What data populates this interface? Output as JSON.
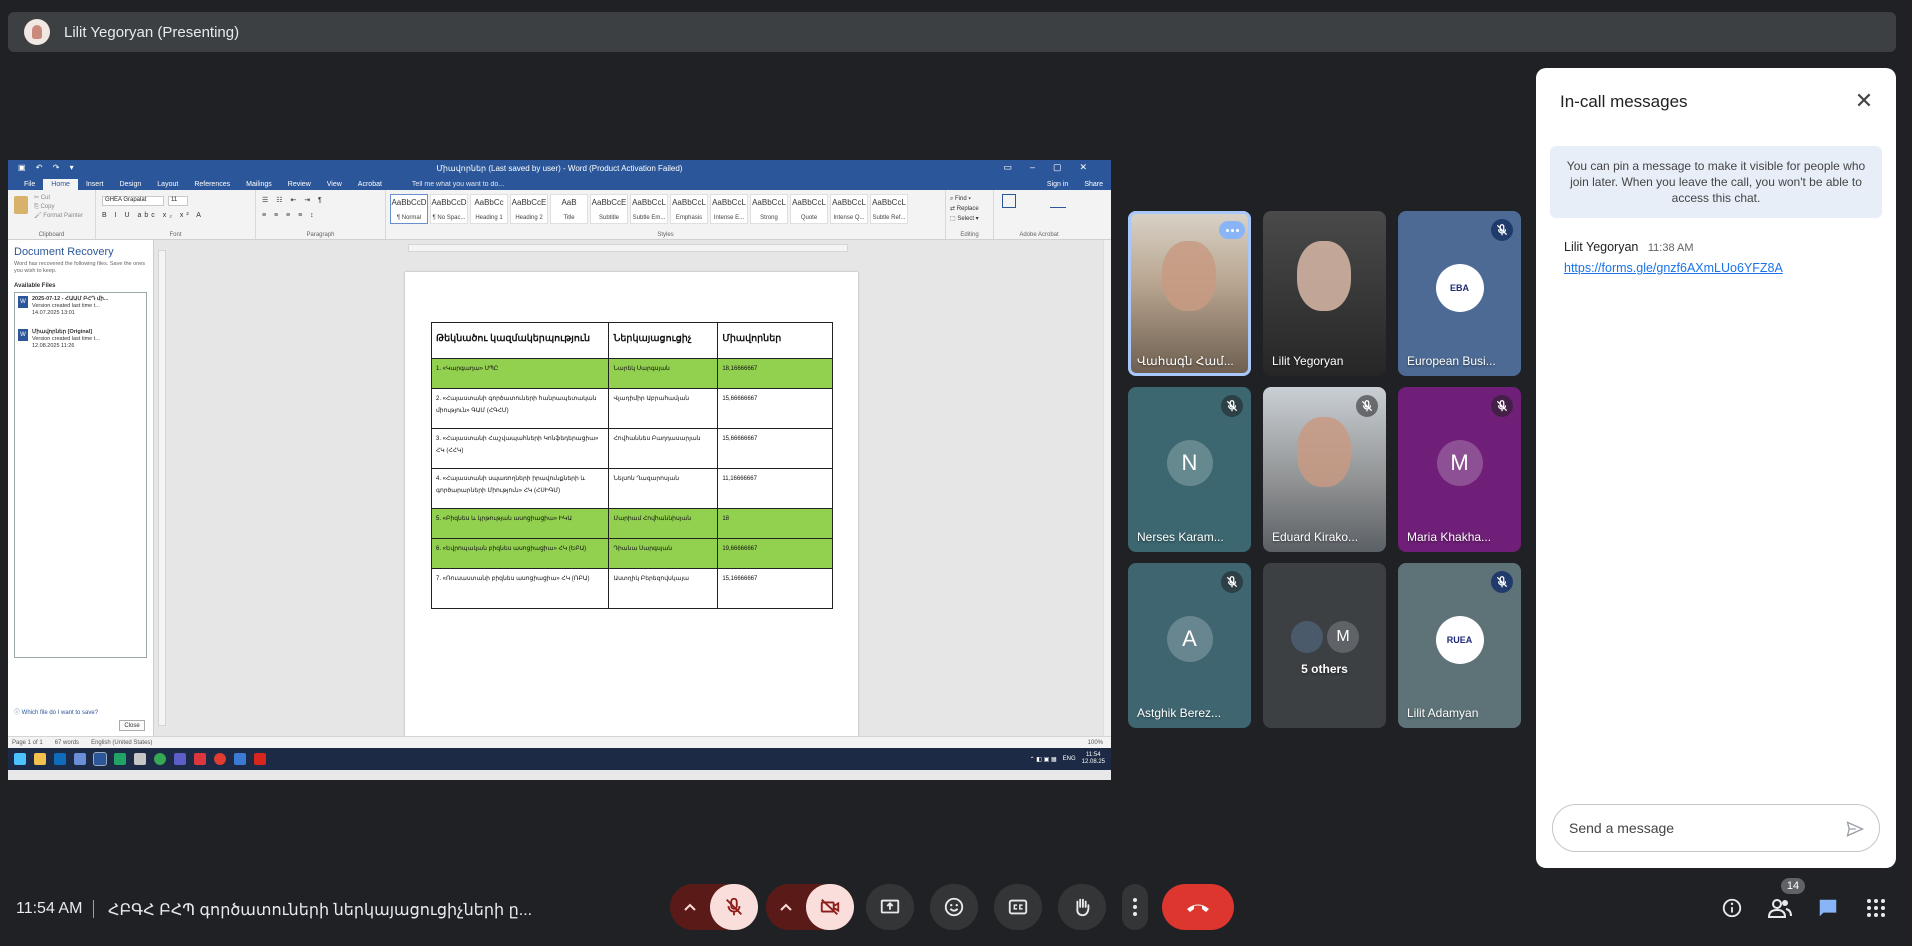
{
  "presenter": {
    "name": "Lilit Yegoryan (Presenting)"
  },
  "word": {
    "window_title": "Միավորներ (Last saved by user) - Word (Product Activation Failed)",
    "tabs": [
      "File",
      "Home",
      "Insert",
      "Design",
      "Layout",
      "References",
      "Mailings",
      "Review",
      "View",
      "Acrobat"
    ],
    "tell_me": "Tell me what you want to do...",
    "sign_in": "Sign in",
    "share": "Share",
    "font_name": "GHEA Grapalat",
    "font_size": "11",
    "groups": [
      "Clipboard",
      "Font",
      "Paragraph",
      "Styles",
      "Editing",
      "Adobe Acrobat"
    ],
    "styles": [
      {
        "sample": "AaBbCcD",
        "name": "¶ Normal"
      },
      {
        "sample": "AaBbCcD",
        "name": "¶ No Spac..."
      },
      {
        "sample": "AaBbCc",
        "name": "Heading 1"
      },
      {
        "sample": "AaBbCcE",
        "name": "Heading 2"
      },
      {
        "sample": "AaB",
        "name": "Title"
      },
      {
        "sample": "AaBbCcE",
        "name": "Subtitle"
      },
      {
        "sample": "AaBbCcL",
        "name": "Subtle Em..."
      },
      {
        "sample": "AaBbCcL",
        "name": "Emphasis"
      },
      {
        "sample": "AaBbCcL",
        "name": "Intense E..."
      },
      {
        "sample": "AaBbCcL",
        "name": "Strong"
      },
      {
        "sample": "AaBbCcL",
        "name": "Quote"
      },
      {
        "sample": "AaBbCcL",
        "name": "Intense Q..."
      },
      {
        "sample": "AaBbCcL",
        "name": "Subtle Ref..."
      }
    ],
    "recovery": {
      "title": "Document Recovery",
      "subtitle": "Word has recovered the following files. Save the ones you wish to keep.",
      "available": "Available Files",
      "files": [
        {
          "name": "2025-07-12 - ՀԱԱՄ ԲՀԴ մի...",
          "line1": "Version created last time t...",
          "line2": "14.07.2025 13:01"
        },
        {
          "name": "Միավորներ  [Original]",
          "line1": "Version created last time t...",
          "line2": "12.08.2025 11:26"
        }
      ],
      "help": "Which file do I want to save?",
      "close": "Close"
    },
    "table": {
      "headers": [
        "Թեկնածու կազմակերպություն",
        "Ներկայացուցիչ",
        "Միավորներ"
      ],
      "rows": [
        {
          "org": "1. «Կարգադա» ՍՊԸ",
          "rep": "Նարեկ Սարգսյան",
          "score": "18,16666667",
          "hl": true
        },
        {
          "org": "2. «Հայաստանի գործատուների հանրապետական միություն» ԳԱՄ (ՀԳՀՄ)",
          "rep": "Վլադիմիր Աբրահամյան",
          "score": "15,66666667",
          "hl": false
        },
        {
          "org": "3. «Հայաստանի Հաշվապահների Կոնֆեդերացիա» ՀԿ (ՀՀԿ)",
          "rep": "Հովհաննես Բաղդասարյան",
          "score": "15,66666667",
          "hl": false
        },
        {
          "org": "4. «Հայաստանի սպառողների իրավունքների և գործարարների Միություն» ՀԿ (ՀՍԻԳՄ)",
          "rep": "Նելսոն Ղազարոսյան",
          "score": "11,16666667",
          "hl": false
        },
        {
          "org": "5. «Բիզնես և կրթության ասոցիացիա» ԻԿԱ",
          "rep": "Մարիամ Հովհաննիսյան",
          "score": "18",
          "hl": true
        },
        {
          "org": "6. «Եվրոպական բիզնես ասոցիացիա» ՀԿ (ԵԲԱ)",
          "rep": "Դիանա Սարգսյան",
          "score": "19,66666667",
          "hl": true
        },
        {
          "org": "7. «Ռուսաստանի բիզնես ասոցիացիա» ՀԿ (ՌԲԱ)",
          "rep": "Աստղիկ Բերեզովսկայա",
          "score": "15,16666667",
          "hl": false
        }
      ]
    },
    "status": {
      "page": "Page 1 of 1",
      "words": "67 words",
      "lang": "English (United States)",
      "zoom": "100%"
    },
    "taskbar": {
      "lang": "ENG",
      "time": "11:54",
      "date": "12.08.25"
    }
  },
  "participants": [
    {
      "name": "Վահագն Համ...",
      "type": "video",
      "muted": false,
      "speaking": true
    },
    {
      "name": "Lilit Yegoryan",
      "type": "video",
      "muted": false,
      "speaking": false
    },
    {
      "name": "European Busi...",
      "type": "logo",
      "logo": "EBA",
      "muted": true,
      "bg": "#4c6a93"
    },
    {
      "name": "Nerses Karam...",
      "type": "avatar",
      "initial": "N",
      "muted": true,
      "bg": "#3c6770"
    },
    {
      "name": "Eduard Kirako...",
      "type": "video",
      "muted": true
    },
    {
      "name": "Maria Khakha...",
      "type": "avatar",
      "initial": "M",
      "muted": true,
      "bg": "#6f1f77"
    },
    {
      "name": "Astghik Berez...",
      "type": "avatar",
      "initial": "A",
      "muted": true,
      "bg": "#3e6570"
    },
    {
      "name": "5 others",
      "type": "others",
      "initial": "M",
      "muted": false,
      "bg": "#3c4043"
    },
    {
      "name": "Lilit Adamyan",
      "type": "logo",
      "logo": "RUEA",
      "muted": true,
      "bg": "#5d7378"
    }
  ],
  "chat": {
    "title": "In-call messages",
    "info": "You can pin a message to make it visible for people who join later. When you leave the call, you won't be able to access this chat.",
    "messages": [
      {
        "author": "Lilit Yegoryan",
        "time": "11:38 AM",
        "text": "https://forms.gle/gnzf6AXmLUo6YFZ8A"
      }
    ],
    "placeholder": "Send a message"
  },
  "bottom": {
    "time": "11:54 AM",
    "meeting_title": "ՀԲԳՀ ԲՀՊ գործատուների ներկայացուցիչների ը...",
    "participant_count": "14"
  },
  "colors": {
    "accent": "#8ab4f8",
    "end_call": "#dc362e",
    "muted_bg": "#f9dedc",
    "highlight": "#92d050",
    "word_blue": "#2b579a"
  }
}
